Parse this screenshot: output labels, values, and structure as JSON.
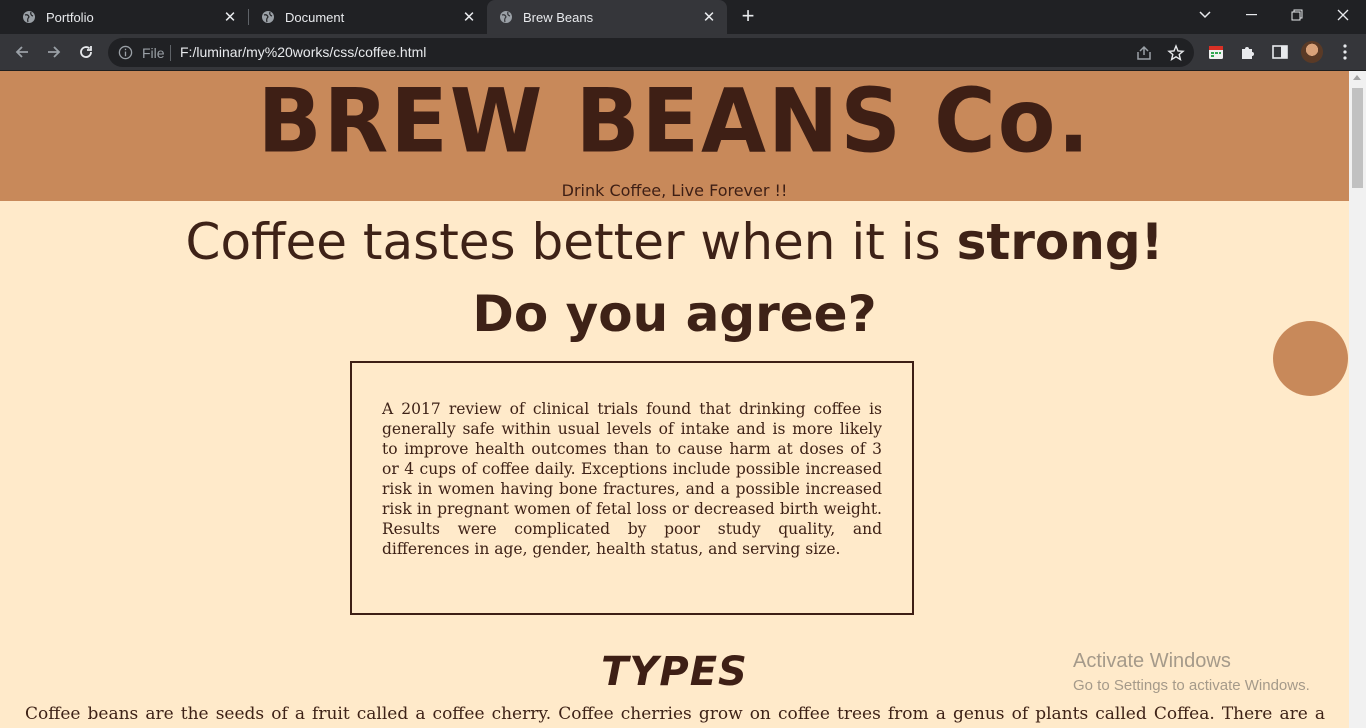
{
  "browser": {
    "tabs": [
      {
        "title": "Portfolio",
        "close": "✕"
      },
      {
        "title": "Document",
        "close": "✕"
      },
      {
        "title": "Brew Beans",
        "close": "✕",
        "active": true
      }
    ],
    "new_tab": "+",
    "omnibox": {
      "security_label": "File",
      "url": "F:/luminar/my%20works/css/coffee.html"
    },
    "icons": [
      "back-icon",
      "forward-icon",
      "reload-icon",
      "info-icon",
      "share-icon",
      "star-icon",
      "extension-calendar-icon",
      "puzzle-icon",
      "sidepanel-icon",
      "avatar",
      "menu-icon",
      "minimize-icon",
      "restore-icon",
      "close-icon",
      "tab-search-icon"
    ]
  },
  "page": {
    "brand": "BREW BEANS Co.",
    "tagline": "Drink Coffee, Live Forever !!",
    "headline_prefix": "Coffee tastes better when it is ",
    "headline_strong": "strong!",
    "question": "Do you agree?",
    "info_text": "A 2017 review of clinical trials found that drinking coffee is generally safe within usual levels of intake and is more likely to improve health outcomes than to cause harm at doses of 3 or 4 cups of coffee daily. Exceptions include possible increased risk in women having bone fractures, and a possible increased risk in pregnant women of fetal loss or decreased birth weight. Results were complicated by poor study quality, and differences in age, gender, health status, and serving size.",
    "types_heading": "TYPES",
    "types_text": "Coffee beans are the seeds of a fruit called a coffee cherry. Coffee cherries grow on coffee trees from a genus of plants called Coffea. There are a wide variety of",
    "colors": {
      "hero": "#c8895a",
      "background": "#ffeaca",
      "text": "#3e1f15"
    }
  },
  "os_overlay": {
    "title": "Activate Windows",
    "subtitle": "Go to Settings to activate Windows."
  }
}
